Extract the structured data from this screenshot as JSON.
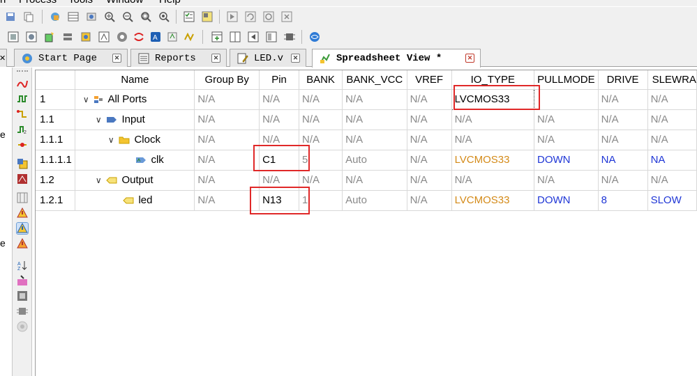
{
  "menu": {
    "items": [
      "n",
      "Process",
      "Tools",
      "Window",
      "Help"
    ]
  },
  "tabs": [
    {
      "label": "Start Page",
      "icon": "globe-icon"
    },
    {
      "label": "Reports",
      "icon": "report-icon"
    },
    {
      "label": "LED.v",
      "icon": "file-edit-icon"
    },
    {
      "label": "Spreadsheet View *",
      "icon": "spreadsheet-icon",
      "active": true
    }
  ],
  "left_strip": {
    "labels": [
      "e",
      "e"
    ]
  },
  "table": {
    "columns": [
      "",
      "Name",
      "Group By",
      "Pin",
      "BANK",
      "BANK_VCC",
      "VREF",
      "IO_TYPE",
      "PULLMODE",
      "DRIVE",
      "SLEWRA"
    ],
    "rows": [
      {
        "index": "1",
        "name": "All Ports",
        "icon": "all-ports-icon",
        "expanded": true,
        "level": 0,
        "cells": [
          "N/A",
          "N/A",
          "N/A",
          "N/A",
          "N/A",
          "LVCMOS33",
          "",
          "N/A",
          "N/A"
        ]
      },
      {
        "index": "1.1",
        "name": "Input",
        "icon": "input-icon",
        "expanded": true,
        "level": 1,
        "cells": [
          "N/A",
          "N/A",
          "N/A",
          "N/A",
          "N/A",
          "N/A",
          "N/A",
          "N/A",
          "N/A"
        ]
      },
      {
        "index": "1.1.1",
        "name": "Clock",
        "icon": "folder-icon",
        "expanded": true,
        "level": 2,
        "cells": [
          "N/A",
          "N/A",
          "N/A",
          "N/A",
          "N/A",
          "N/A",
          "N/A",
          "N/A",
          "N/A"
        ]
      },
      {
        "index": "1.1.1.1",
        "name": "clk",
        "icon": "clk-port-icon",
        "level": 3,
        "cells": [
          "N/A",
          "C1",
          "5",
          "Auto",
          "N/A",
          "LVCMOS33",
          "DOWN",
          "NA",
          "NA"
        ]
      },
      {
        "index": "1.2",
        "name": "Output",
        "icon": "output-icon",
        "expanded": true,
        "level": 1,
        "cells": [
          "N/A",
          "N/A",
          "N/A",
          "N/A",
          "N/A",
          "N/A",
          "N/A",
          "N/A",
          "N/A"
        ]
      },
      {
        "index": "1.2.1",
        "name": "led",
        "icon": "led-port-icon",
        "level": 2,
        "cells": [
          "N/A",
          "N13",
          "1",
          "Auto",
          "N/A",
          "LVCMOS33",
          "DOWN",
          "8",
          "SLOW"
        ]
      }
    ]
  },
  "colors": {
    "accent_blue": "#1f36d6",
    "io_type_orange": "#d48a18",
    "highlight_red": "#e02828",
    "na_gray": "#8a8a8a"
  }
}
